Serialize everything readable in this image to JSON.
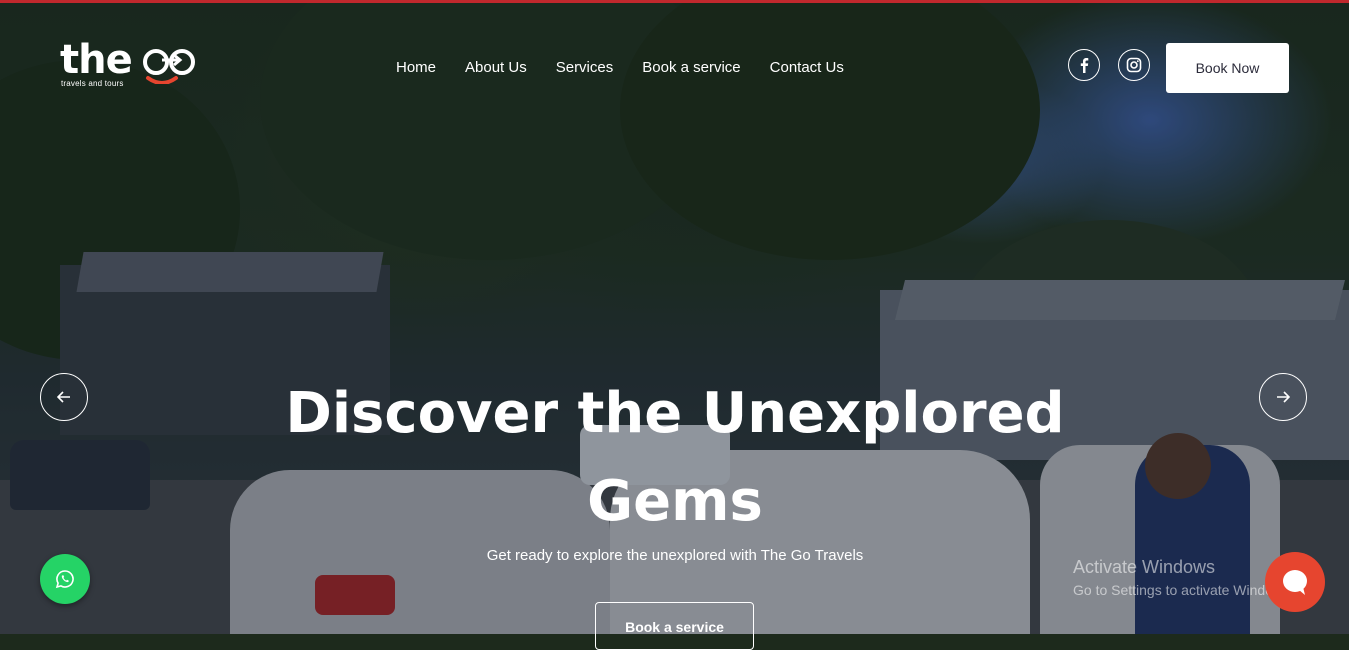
{
  "brand": {
    "logo_word": "the",
    "logo_tagline": "travels and tours",
    "accent_color": "#e6452f"
  },
  "nav": {
    "items": [
      {
        "label": "Home"
      },
      {
        "label": "About Us"
      },
      {
        "label": "Services"
      },
      {
        "label": "Book a service"
      },
      {
        "label": "Contact Us"
      }
    ]
  },
  "header": {
    "social_icons": [
      "facebook-icon",
      "instagram-icon"
    ],
    "book_now_label": "Book Now"
  },
  "hero": {
    "headline": "Discover the Unexplored Gems",
    "subheadline": "Get ready to explore the unexplored with The Go Travels",
    "cta_label": "Book a service",
    "prev_icon": "arrow-left-icon",
    "next_icon": "arrow-right-icon"
  },
  "widgets": {
    "whatsapp_icon": "whatsapp-icon",
    "whatsapp_color": "#25d366",
    "chat_icon": "chat-bubble-icon",
    "chat_color": "#e6452f"
  },
  "watermark": {
    "title": "Activate Windows",
    "subtitle": "Go to Settings to activate Windows."
  }
}
